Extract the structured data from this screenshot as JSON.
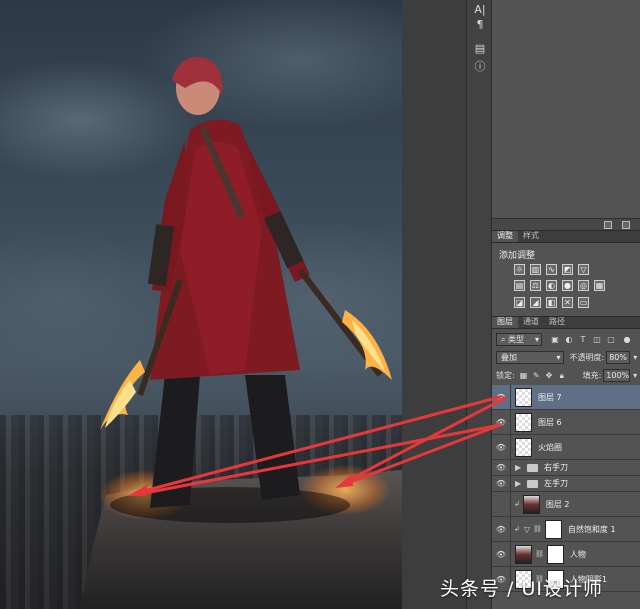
{
  "dock": {
    "icons": [
      "character-icon",
      "paragraph-icon",
      "layer-comps-icon",
      "info-icon"
    ]
  },
  "adjustments": {
    "tabs": [
      "调整",
      "样式"
    ],
    "title": "添加调整"
  },
  "layers_panel": {
    "tabs": [
      "图层",
      "通道",
      "路径"
    ],
    "filter_kind": "类型",
    "blend_mode": "叠加",
    "opacity_label": "不透明度:",
    "opacity_value": "80%",
    "lock_label": "锁定:",
    "fill_label": "填充:",
    "fill_value": "100%",
    "layers": [
      {
        "name": "图层 7",
        "kind": "pixel",
        "selected": true
      },
      {
        "name": "图层 6",
        "kind": "pixel",
        "selected": false
      },
      {
        "name": "火焰圈",
        "kind": "pixel",
        "selected": false
      },
      {
        "name": "右手刀",
        "kind": "group",
        "selected": false
      },
      {
        "name": "左手刀",
        "kind": "group",
        "selected": false
      },
      {
        "name": "图层 2",
        "kind": "clipped-pixel",
        "selected": false
      },
      {
        "name": "自然饱和度 1",
        "kind": "adjustment",
        "selected": false
      },
      {
        "name": "人物",
        "kind": "masked",
        "selected": false
      },
      {
        "name": "人物阴影1",
        "kind": "masked",
        "selected": false
      }
    ]
  },
  "watermark": "头条号 / UI设计师",
  "colors": {
    "panel_bg": "#535353",
    "selected_layer": "#5f6f86",
    "arrow": "#e8373a"
  }
}
